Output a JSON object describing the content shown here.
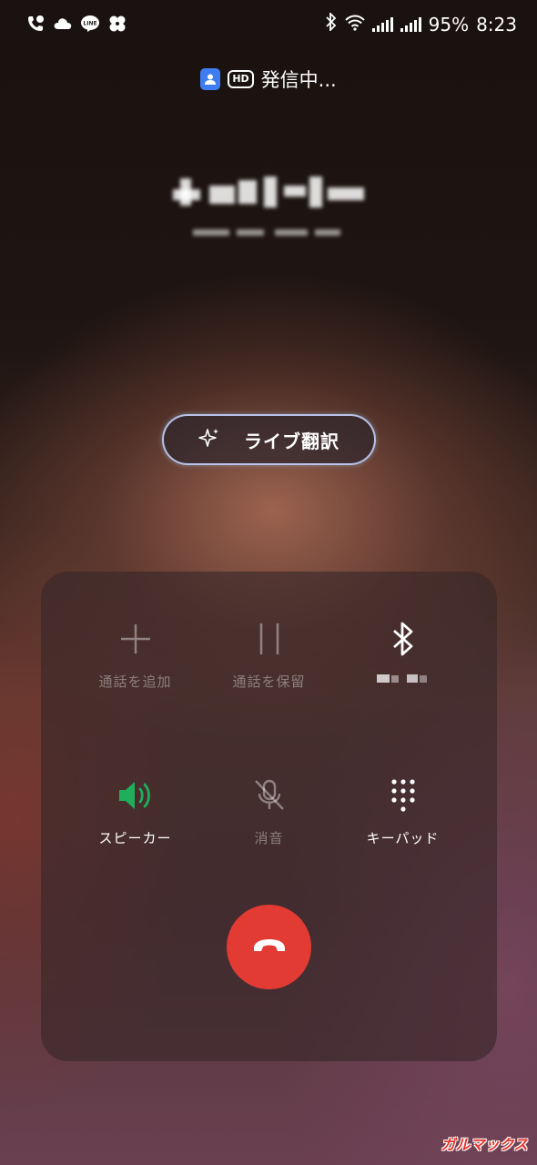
{
  "status_bar": {
    "left_icons": [
      "missed-call-icon",
      "cloud-icon",
      "line-app-icon",
      "pinwheel-icon"
    ],
    "line_label": "LINE",
    "battery": "95%",
    "time": "8:23"
  },
  "call": {
    "status_text": "発信中...",
    "hd_label": "HD"
  },
  "live_translate": {
    "label": "ライブ翻訳"
  },
  "controls": {
    "add_call": "通話を追加",
    "hold_call": "通話を保留",
    "speaker": "スピーカー",
    "mute": "消音",
    "keypad": "キーパッド"
  },
  "colors": {
    "speaker_active": "#1fae5c",
    "end_call": "#e23b34",
    "contact_badge": "#3d7df1"
  },
  "watermark": "ガルマックス"
}
